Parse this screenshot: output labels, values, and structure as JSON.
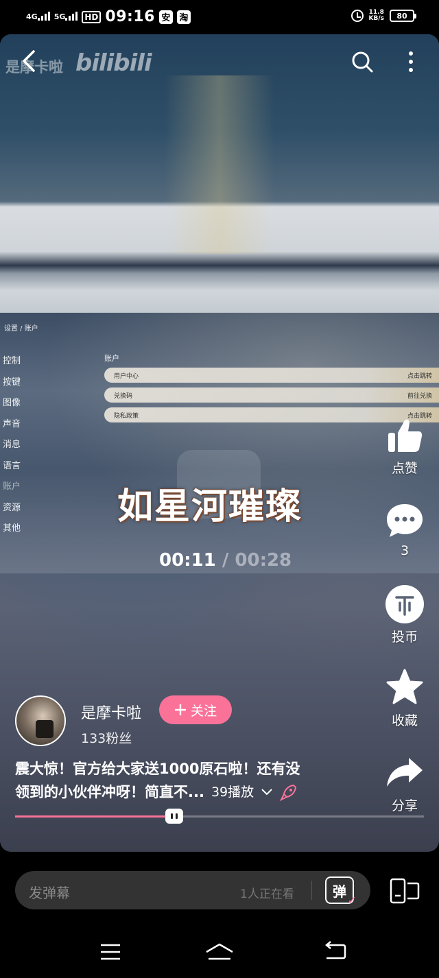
{
  "status_bar": {
    "net1": "4G",
    "net2": "5G",
    "hd": "HD",
    "time": "09:16",
    "app_badge_1": "安",
    "app_badge_2": "淘",
    "speed_value": "11.8",
    "speed_unit": "KB/s",
    "battery": "80"
  },
  "video": {
    "uploader_watermark": "是摩卡啦",
    "logo_watermark": "bilibili",
    "settings_breadcrumb": "设置 / 账户",
    "settings_nav": [
      "控制",
      "按键",
      "图像",
      "声音",
      "消息",
      "语言",
      "账户",
      "资源",
      "其他"
    ],
    "account_title": "账户",
    "account_rows": [
      {
        "label": "用户中心",
        "action": "点击跳转"
      },
      {
        "label": "兑换码",
        "action": "前往兑换"
      },
      {
        "label": "隐私政策",
        "action": "点击跳转"
      }
    ],
    "overlay_title": "如星河璀璨",
    "time_current": "00:11",
    "time_separator": "/",
    "time_total": "00:28",
    "progress_fraction": 0.39
  },
  "rail": {
    "like_label": "点赞",
    "comment_count": "3",
    "coin_label": "投币",
    "favorite_label": "收藏",
    "share_label": "分享"
  },
  "author": {
    "name": "是摩卡啦",
    "follow_label": "关注",
    "fans": "133粉丝"
  },
  "description": {
    "line1": "震大惊！官方给大家送1000原石啦！还有没",
    "line2": "领到的小伙伴冲呀！简直不...",
    "plays": "39播放"
  },
  "comment_bar": {
    "placeholder": "发弹幕",
    "watching": "1人正在看",
    "danmaku_toggle": "弹"
  },
  "colors": {
    "accent": "#fb7299"
  }
}
